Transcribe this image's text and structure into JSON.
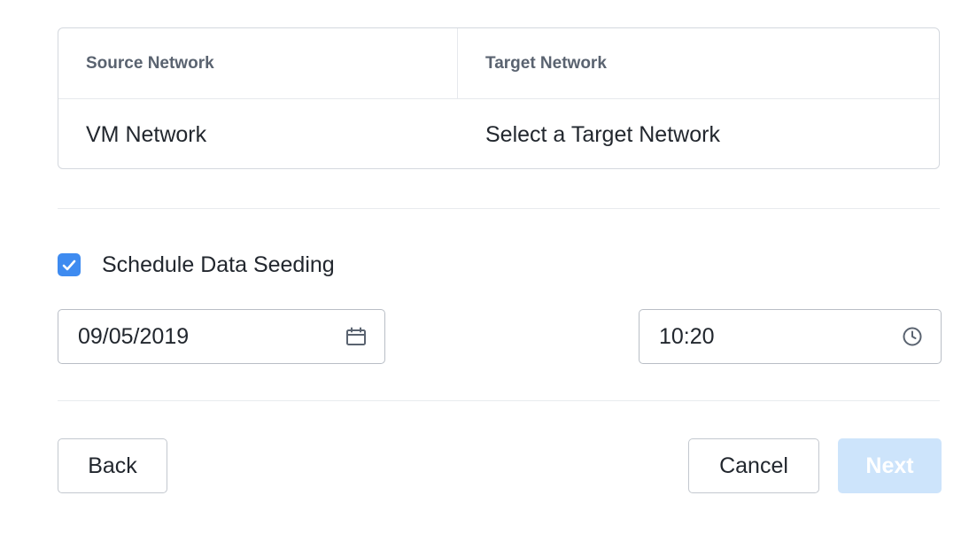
{
  "network_mapping": {
    "headers": {
      "source": "Source Network",
      "target": "Target Network"
    },
    "rows": [
      {
        "source": "VM Network",
        "target": "Select a Target Network"
      }
    ]
  },
  "schedule": {
    "checkbox_label": "Schedule Data Seeding",
    "checked": true,
    "date_value": "09/05/2019",
    "time_value": "10:20",
    "date_icon": "calendar-icon",
    "time_icon": "clock-icon"
  },
  "footer": {
    "back_label": "Back",
    "cancel_label": "Cancel",
    "next_label": "Next",
    "next_disabled": true
  },
  "colors": {
    "accent": "#3e8bf0",
    "next_disabled_bg": "#cde4fb"
  }
}
